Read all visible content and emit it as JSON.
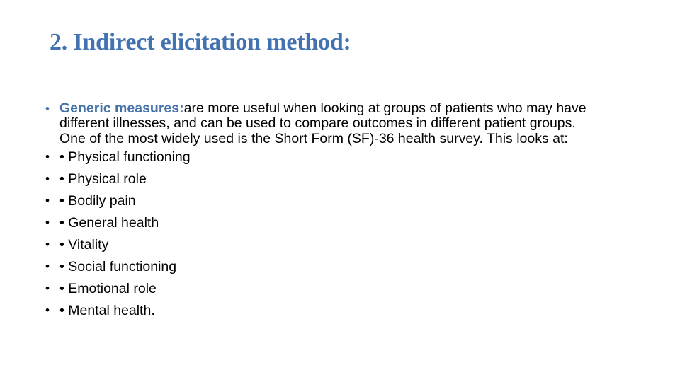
{
  "slide": {
    "title": "2. Indirect elicitation method:",
    "title_color": "#4272AF",
    "background_color": "#ffffff",
    "accent_color": "#4472A8",
    "body_text_color": "#000000",
    "bullet_glyph": "•",
    "paragraph": {
      "marker": "•",
      "lead_label": "Generic measures:",
      "body": "are more useful when looking at groups of patients who may have different illnesses, and can be used to compare outcomes in different patient groups. One of the most widely used is the Short Form (SF)-36 health survey. This looks at:"
    },
    "items": [
      {
        "marker": "•",
        "label": "• Physical functioning"
      },
      {
        "marker": "•",
        "label": "• Physical role"
      },
      {
        "marker": "•",
        "label": "• Bodily pain"
      },
      {
        "marker": "•",
        "label": "• General health"
      },
      {
        "marker": "•",
        "label": "• Vitality"
      },
      {
        "marker": "•",
        "label": "• Social functioning"
      },
      {
        "marker": "•",
        "label": "• Emotional role"
      },
      {
        "marker": "•",
        "label": "• Mental health."
      }
    ]
  }
}
